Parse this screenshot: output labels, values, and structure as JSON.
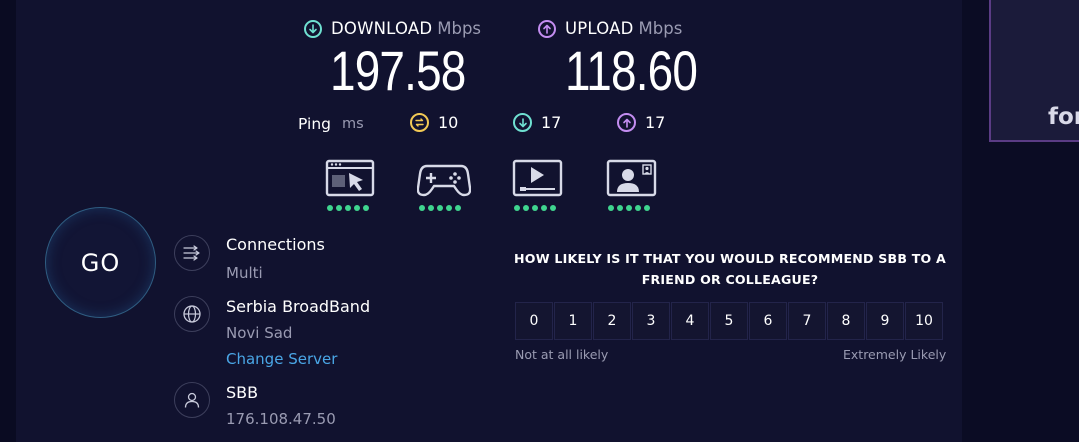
{
  "download": {
    "label": "DOWNLOAD",
    "unit": "Mbps",
    "value": "197.58",
    "icon": "download-arrow-icon"
  },
  "upload": {
    "label": "UPLOAD",
    "unit": "Mbps",
    "value": "118.60",
    "icon": "upload-arrow-icon"
  },
  "ping": {
    "label": "Ping",
    "unit": "ms",
    "idle": "10",
    "download": "17",
    "upload": "17"
  },
  "quality_icons": [
    {
      "icon": "web-browsing-icon",
      "rating": 5
    },
    {
      "icon": "gaming-icon",
      "rating": 5
    },
    {
      "icon": "video-streaming-icon",
      "rating": 5
    },
    {
      "icon": "video-chat-icon",
      "rating": 5
    }
  ],
  "go": {
    "label": "GO"
  },
  "connections": {
    "title": "Connections",
    "value": "Multi"
  },
  "server": {
    "title": "Serbia BroadBand",
    "location": "Novi Sad",
    "change_label": "Change Server"
  },
  "provider": {
    "title": "SBB",
    "ip": "176.108.47.50"
  },
  "survey": {
    "question": "HOW LIKELY IS IT THAT YOU WOULD RECOMMEND SBB TO A FRIEND OR COLLEAGUE?",
    "options": [
      "0",
      "1",
      "2",
      "3",
      "4",
      "5",
      "6",
      "7",
      "8",
      "9",
      "10"
    ],
    "low_label": "Not at all likely",
    "high_label": "Extremely Likely"
  },
  "ad": {
    "text": "for"
  },
  "colors": {
    "download_accent": "#6fe0d1",
    "upload_accent": "#c38df0",
    "ping_idle_accent": "#f2c955",
    "rating_dot": "#3fd58f",
    "link": "#4aa6e6"
  }
}
